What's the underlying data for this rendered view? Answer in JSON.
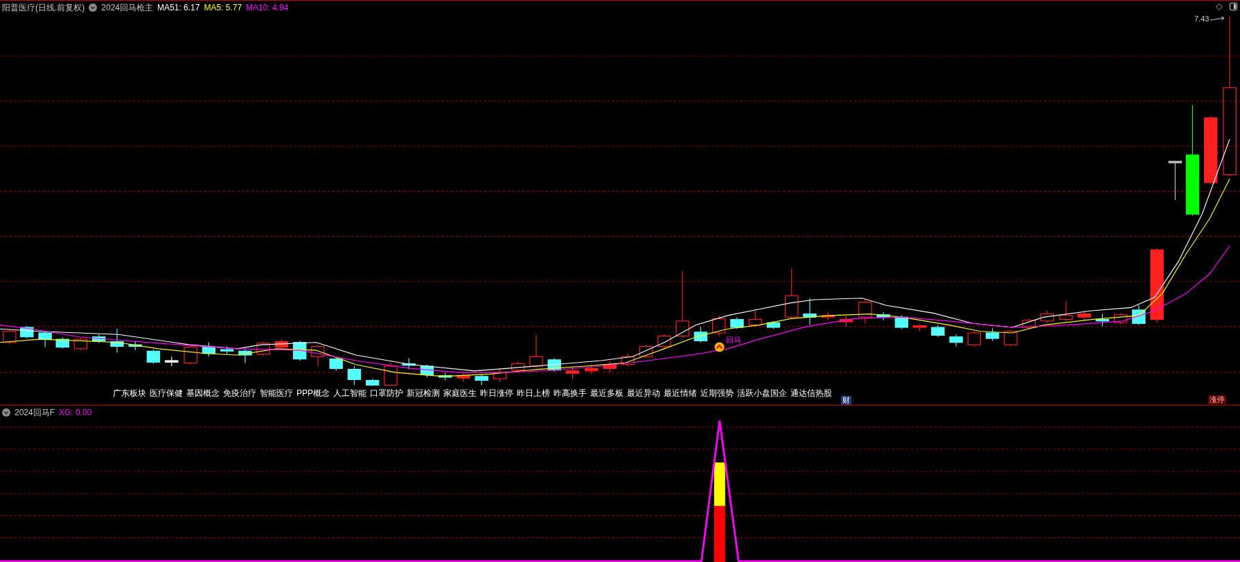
{
  "main_panel": {
    "title": "阳普医疗(日线.前复权)",
    "indicator": "2024回马枪主",
    "ma_values": [
      {
        "label": "MA51: 6.17",
        "color": "#ffffff"
      },
      {
        "label": "MA5: 5.77",
        "color": "#ffff00"
      },
      {
        "label": "MA10: 4.94",
        "color": "#ff00ff"
      }
    ],
    "price_marker": "7.43",
    "signal_label": "回马",
    "concepts": [
      "广东板块",
      "医疗保健",
      "基因概念",
      "免疫治疗",
      "智能医疗",
      "PPP概念",
      "人工智能",
      "口罩防护",
      "新冠检测",
      "家庭医生",
      "昨日涨停",
      "昨日上榜",
      "昨高换手",
      "最近多板",
      "最近异动",
      "最近情绪",
      "近期强势",
      "活跃小盘国企",
      "通达信热股"
    ],
    "finance_badge": "财",
    "limit_badge": "涨停"
  },
  "sub_panel": {
    "indicator": "2024回马F",
    "value": "XG: 0.00"
  }
}
